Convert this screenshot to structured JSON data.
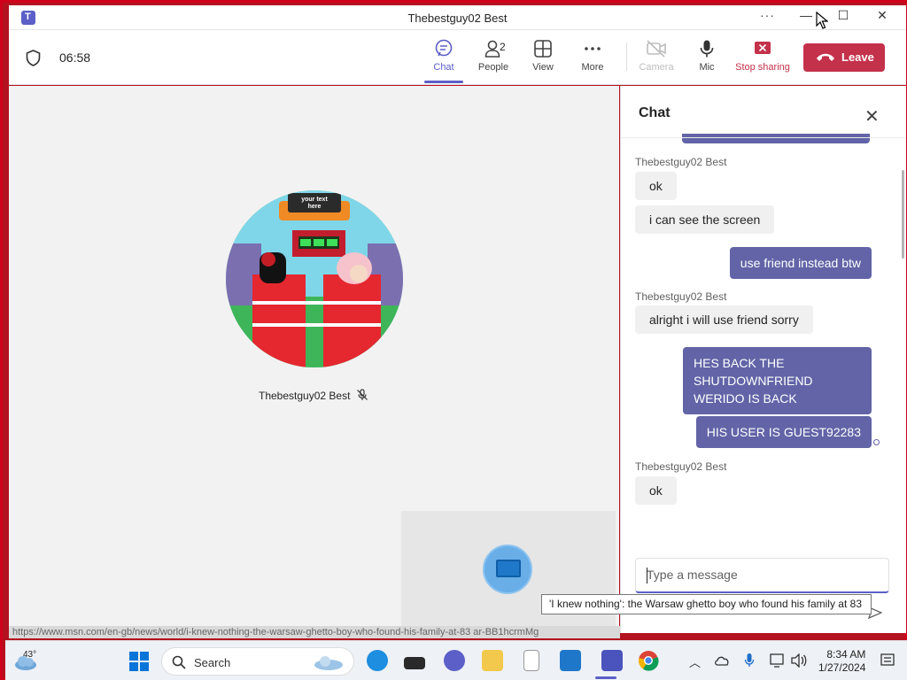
{
  "window": {
    "title": "Thebestguy02 Best",
    "more_label": "···",
    "minimize_label": "—",
    "maximize_label": "☐",
    "close_label": "✕"
  },
  "toolbar": {
    "timer": "06:58",
    "chat_label": "Chat",
    "people_label": "People",
    "people_count": "2",
    "view_label": "View",
    "more_label": "More",
    "camera_label": "Camera",
    "mic_label": "Mic",
    "stop_sharing_label": "Stop sharing",
    "leave_label": "Leave",
    "accent_color": "#5b5fc7",
    "leave_color": "#c4314b"
  },
  "stage": {
    "participant_name": "Thebestguy02 Best",
    "avatar_sign_text": "your text here"
  },
  "chat": {
    "title": "Chat",
    "messages": [
      {
        "sender": "Thebestguy02 Best",
        "text": "ok"
      },
      {
        "text": "i can see the screen"
      },
      {
        "text": "use friend instead btw"
      },
      {
        "sender": "Thebestguy02 Best",
        "text": "alright i will use friend sorry"
      },
      {
        "text": "HES BACK THE SHUTDOWNFRIEND WERIDO IS BACK"
      },
      {
        "text": "HIS USER IS GUEST92283"
      },
      {
        "sender": "Thebestguy02 Best",
        "text": "ok"
      }
    ],
    "compose_placeholder": "Type a message"
  },
  "tooltip": {
    "text": "'I knew nothing': the Warsaw ghetto boy who found his family at 83"
  },
  "ticker": {
    "text": "https://www.msn.com/en-gb/news/world/i-knew-nothing-the-warsaw-ghetto-boy-who-found-his-family-at-83 ar-BB1hcrmMg"
  },
  "taskbar": {
    "weather_temp": "43°",
    "search_label": "Search",
    "time": "8:34 AM",
    "date": "1/27/2024"
  }
}
